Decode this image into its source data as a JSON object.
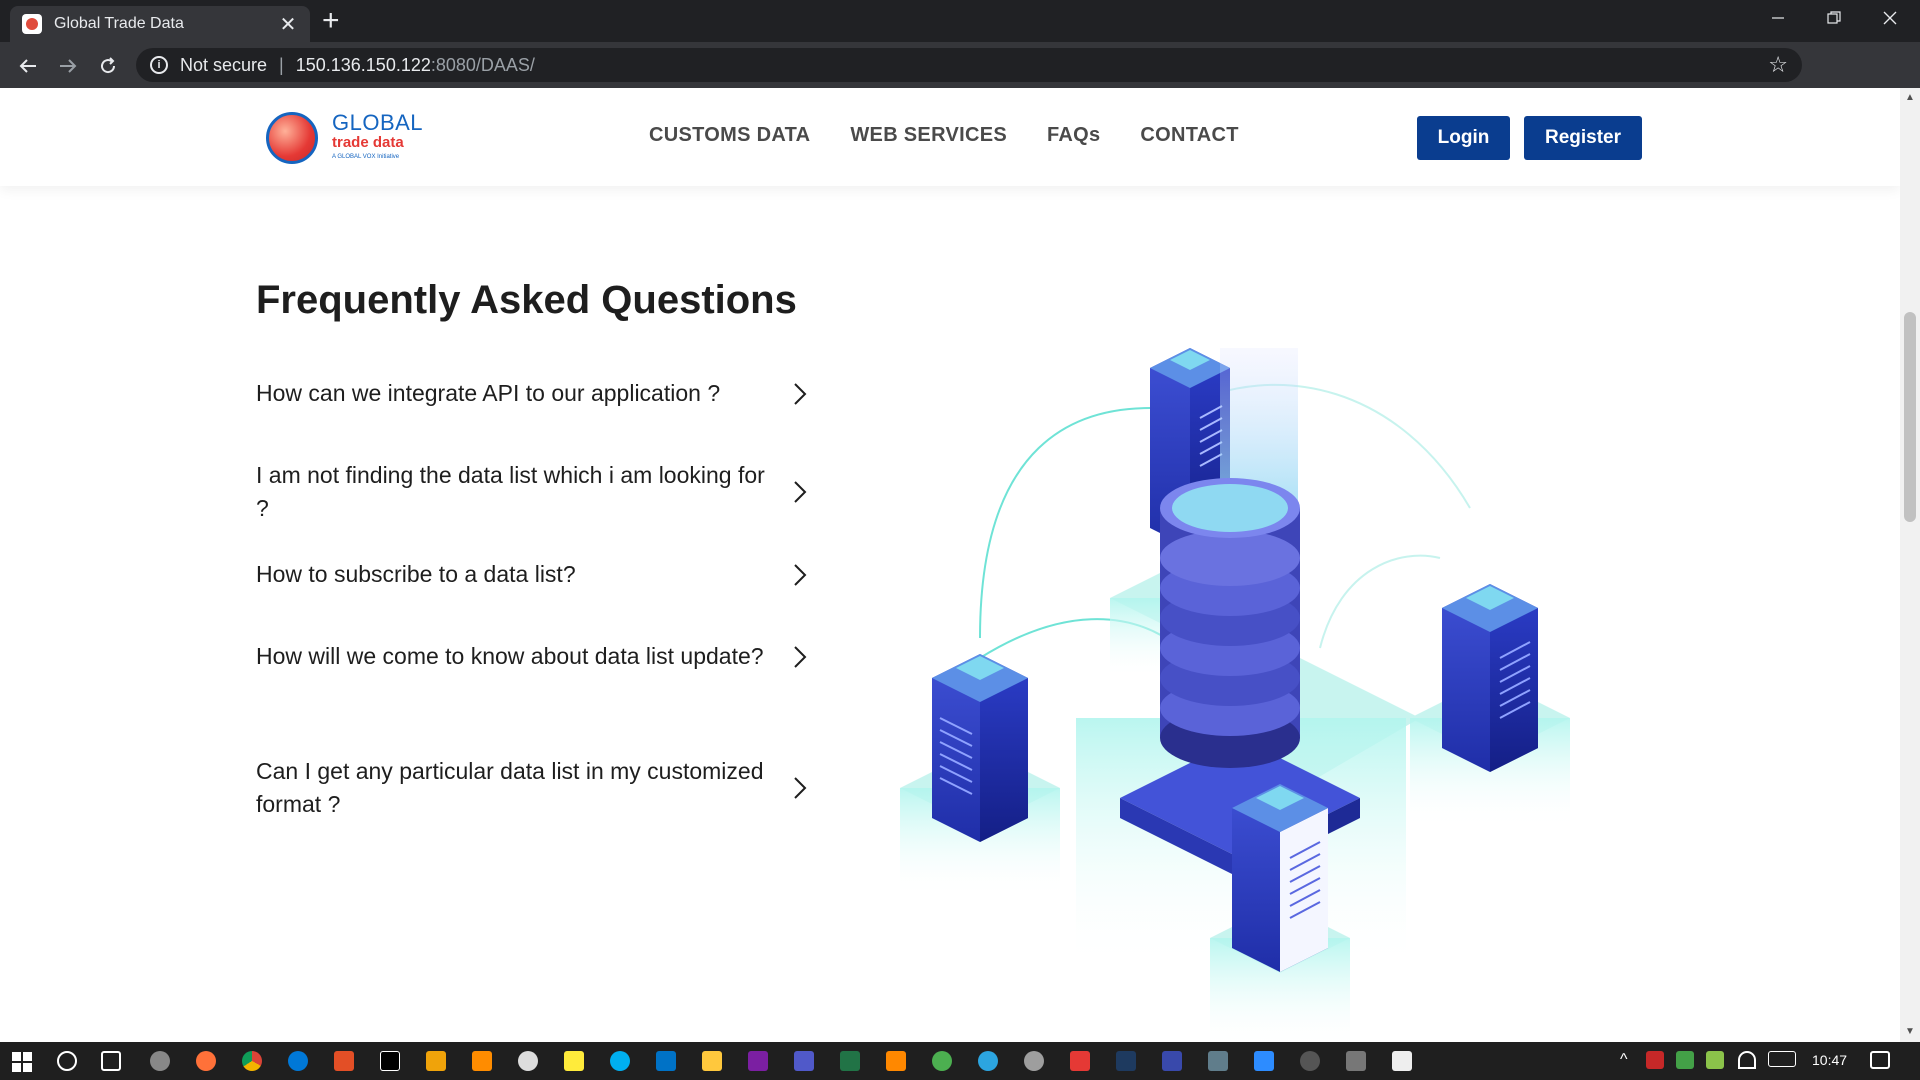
{
  "browser": {
    "tab_title": "Global Trade Data",
    "tab_close": "✕",
    "new_tab": "+",
    "security_label": "Not secure",
    "url_host": "150.136.150.122",
    "url_path": ":8080/DAAS/"
  },
  "site": {
    "logo": {
      "line1": "GLOBAL",
      "line2": "trade data",
      "line3": "A GLOBAL VOX Initiative"
    },
    "nav": [
      "CUSTOMS DATA",
      "WEB SERVICES",
      "FAQs",
      "CONTACT"
    ],
    "login": "Login",
    "register": "Register"
  },
  "faq": {
    "title": "Frequently Asked Questions",
    "items": [
      "How can we integrate API to our application ?",
      "I am not finding the data list which i am looking for ?",
      "How to subscribe to a data list?",
      "How will we come to know about data list update?",
      "Can I get any particular data list in my customized format ?"
    ]
  },
  "taskbar": {
    "time": "10:47"
  },
  "colors": {
    "primary_button": "#0a3d8f",
    "nav_text": "#4a4a4a",
    "chrome_dark": "#202124",
    "chrome_mid": "#35363a"
  }
}
